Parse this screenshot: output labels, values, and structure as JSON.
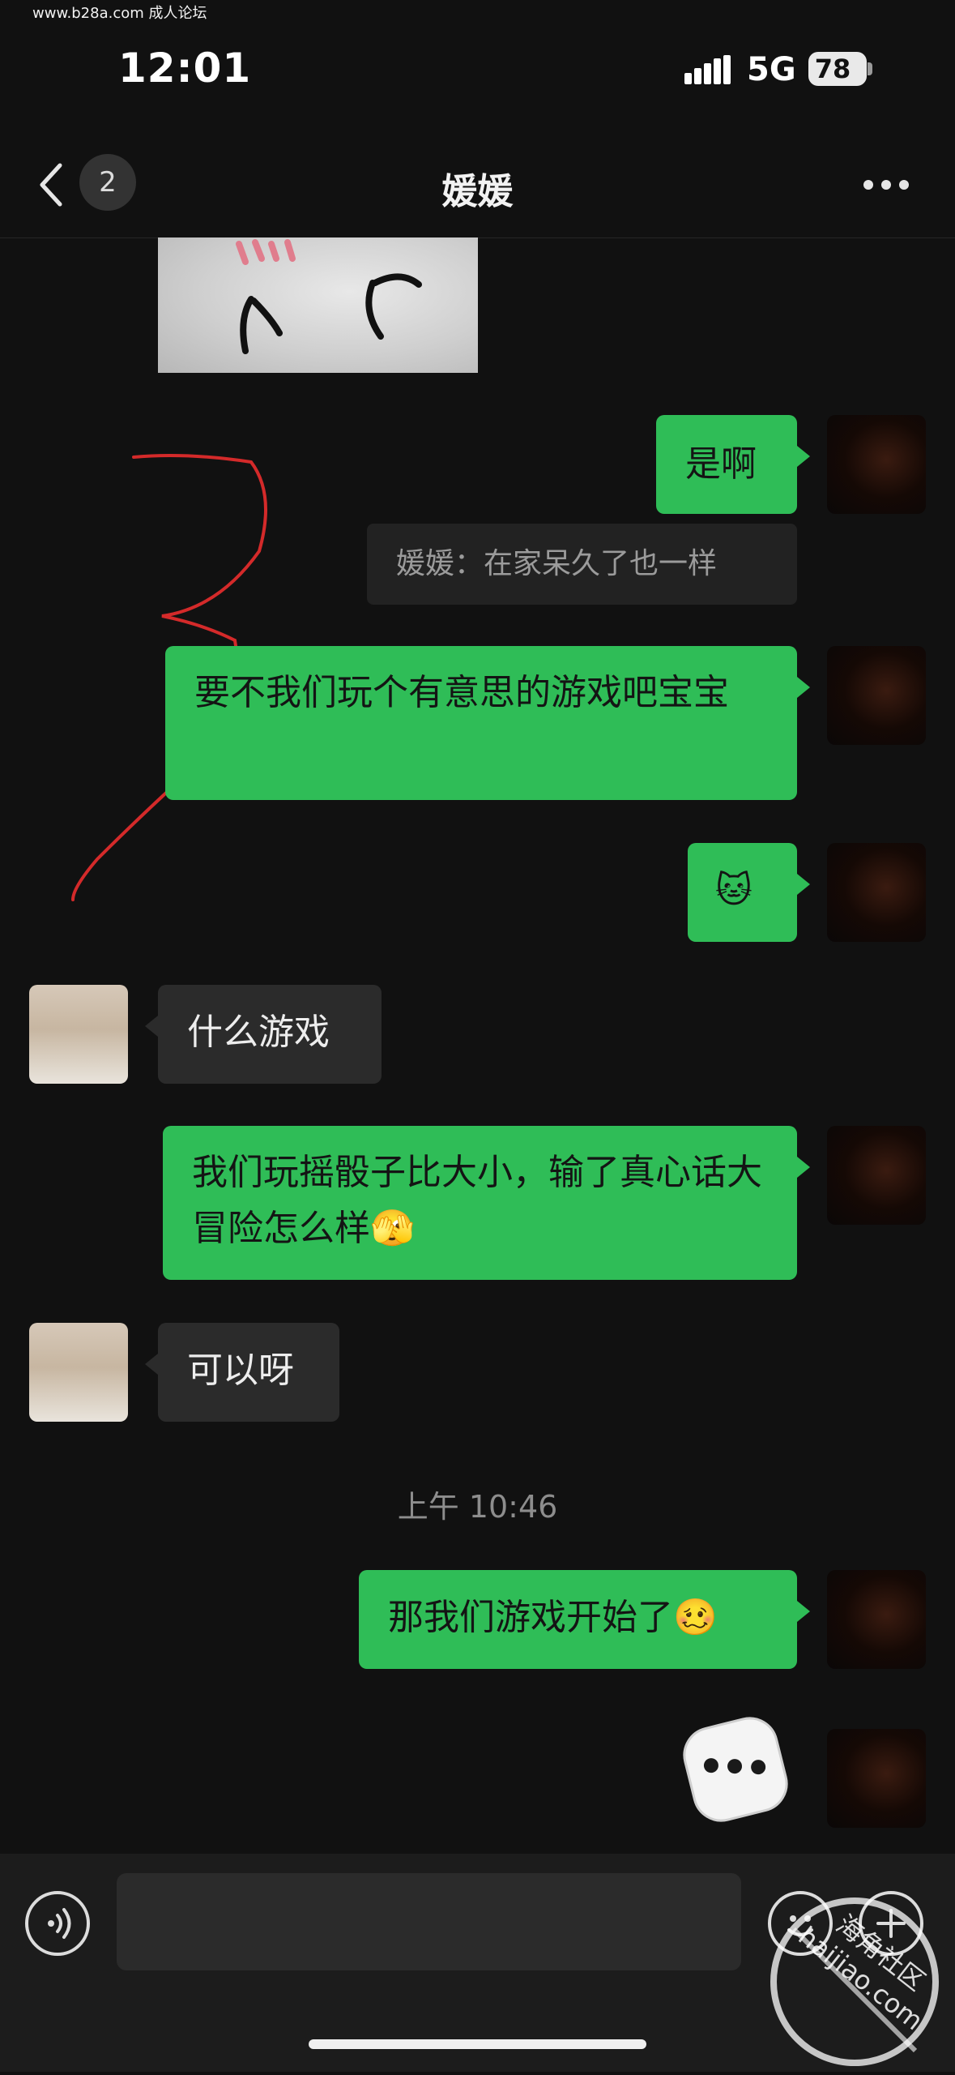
{
  "watermark_top": "www.b28a.com 成人论坛",
  "status": {
    "time": "12:01",
    "network": "5G",
    "battery": "78"
  },
  "nav": {
    "unread_count": "2",
    "title": "媛媛"
  },
  "messages": [
    {
      "side": "me",
      "text": "是啊"
    },
    {
      "side": "quote",
      "text": "媛媛：在家呆久了也一样"
    },
    {
      "side": "me",
      "text": "要不我们玩个有意思的游戏吧宝宝"
    },
    {
      "side": "me",
      "text": "🐱"
    },
    {
      "side": "her",
      "text": "什么游戏"
    },
    {
      "side": "me",
      "text": "我们玩摇骰子比大小，输了真心话大冒险怎么样🫣"
    },
    {
      "side": "her",
      "text": "可以呀"
    },
    {
      "side": "time",
      "text": "上午 10:46"
    },
    {
      "side": "me",
      "text": "那我们游戏开始了🥴"
    },
    {
      "side": "me",
      "text": "dice",
      "dice_value": 3
    }
  ],
  "input": {
    "placeholder": ""
  },
  "watermark_bottom": "海角社区 haijiao.com",
  "icons": {
    "back": "chevron-left-icon",
    "more": "ellipsis-icon",
    "voice": "voice-icon",
    "emoji": "emoji-icon",
    "plus": "plus-icon"
  },
  "colors": {
    "my_bubble": "#2fbd57",
    "her_bubble": "#2b2b2b",
    "background": "#111111"
  }
}
